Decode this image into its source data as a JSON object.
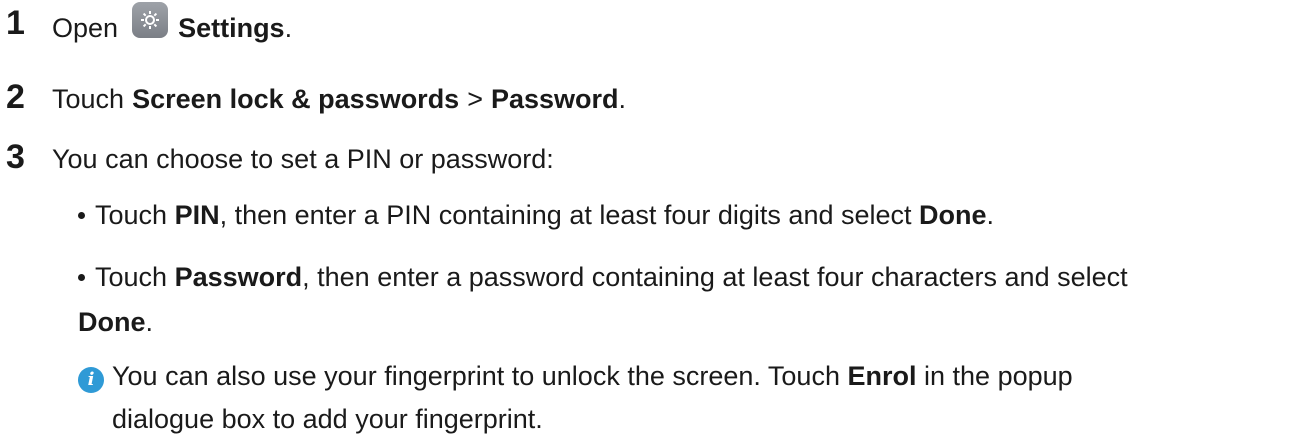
{
  "steps": [
    {
      "number": "1",
      "before": "Open",
      "icon": "settings-icon",
      "bold": "Settings",
      "after": "."
    },
    {
      "number": "2",
      "before": "Touch",
      "bold1": "Screen lock & passwords",
      "sep": ">",
      "bold2": "Password",
      "after": "."
    },
    {
      "number": "3",
      "text": "You can choose to set a PIN or password:"
    }
  ],
  "bullets": [
    {
      "before": "Touch",
      "bold1": "PIN",
      "middle": ", then enter a PIN containing at least four digits and select",
      "bold2": "Done",
      "after": "."
    },
    {
      "before": "Touch",
      "bold1": "Password",
      "middle": ", then enter a password containing at least four characters and select",
      "bold2": "Done",
      "after": "."
    }
  ],
  "note": {
    "icon": "info-icon",
    "icon_glyph": "i",
    "line1_before": "You can also use your fingerprint to unlock the screen. Touch",
    "line1_bold": "Enrol",
    "line1_after": "in the popup",
    "line2": "dialogue box to add your fingerprint."
  },
  "colors": {
    "text": "#1a1a1a",
    "info_icon": "#2f9ad6",
    "settings_icon": "#8a8e94"
  }
}
